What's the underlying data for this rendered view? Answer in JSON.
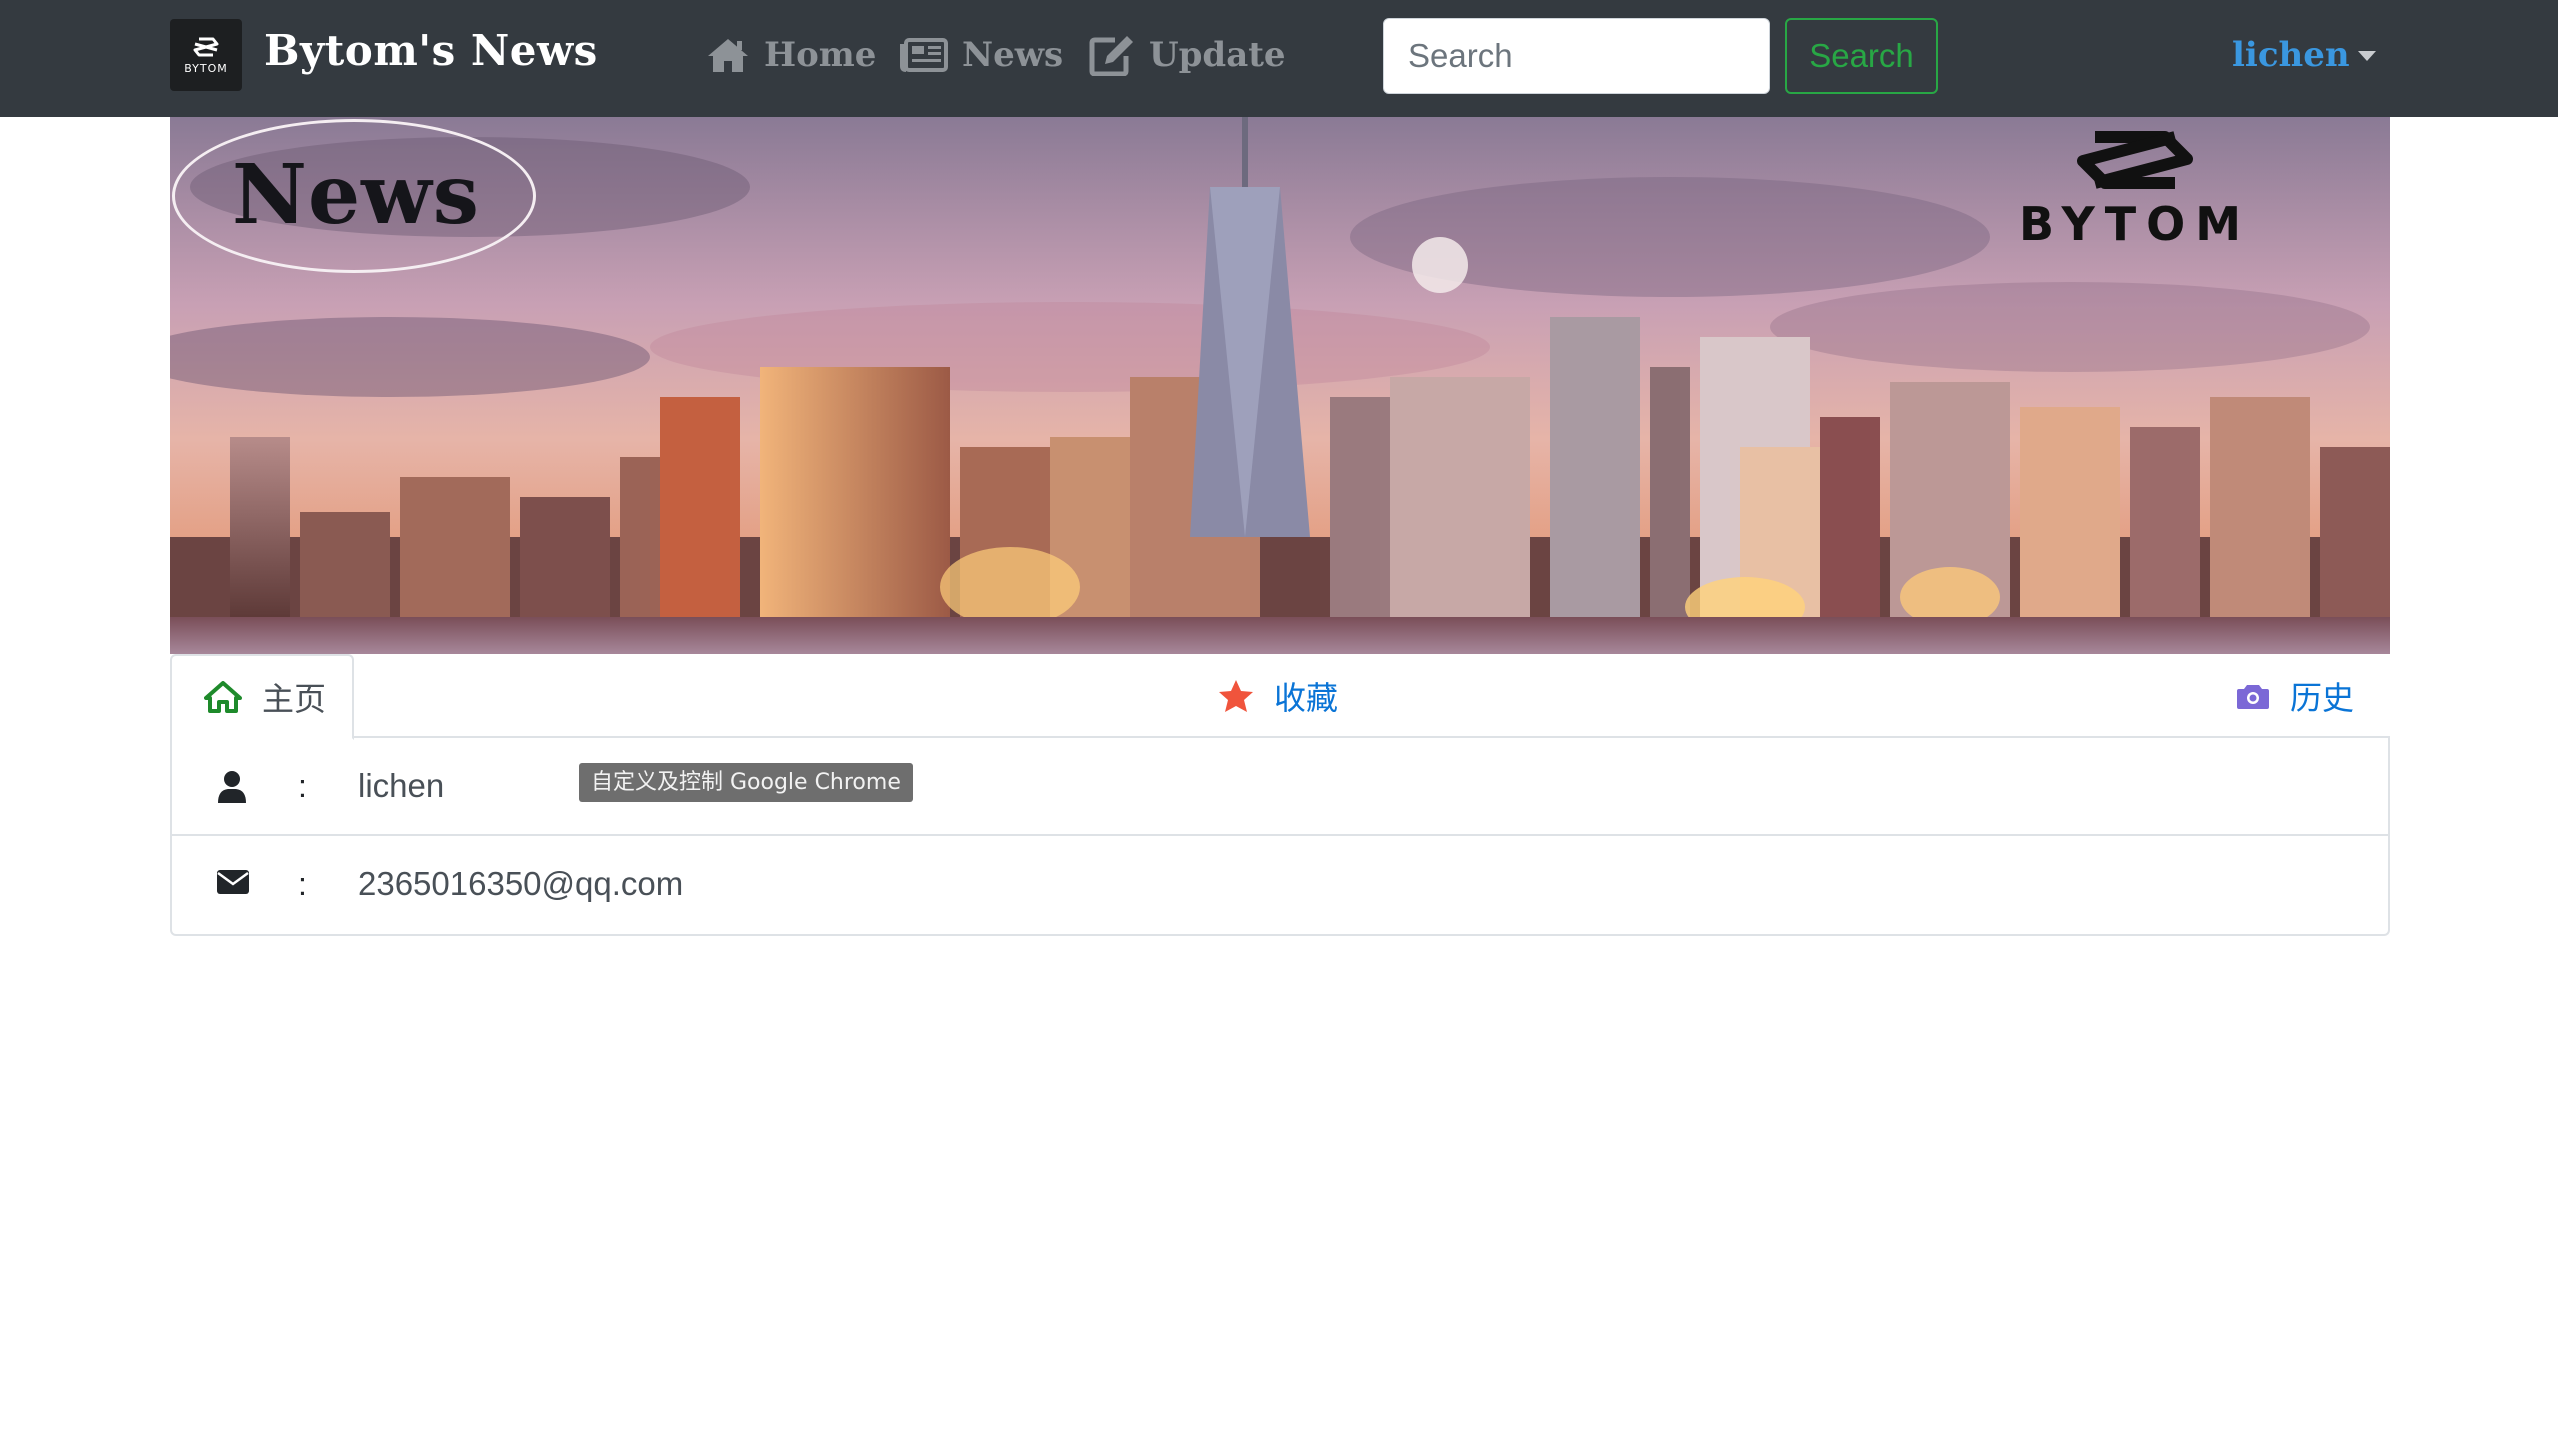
{
  "navbar": {
    "brand_logo_text": "BYTOM",
    "brand_title": "Bytom's News",
    "links": [
      {
        "label": "Home",
        "icon": "home-icon"
      },
      {
        "label": "News",
        "icon": "newspaper-icon"
      },
      {
        "label": "Update",
        "icon": "edit-icon"
      }
    ],
    "search": {
      "placeholder": "Search",
      "value": "",
      "button_label": "Search"
    },
    "user": {
      "name": "lichen",
      "icon": "chevron-down-icon"
    }
  },
  "banner": {
    "title": "News",
    "logo_text": "BYTOM"
  },
  "tabs": [
    {
      "label": "主页",
      "icon": "home-icon",
      "active": true
    },
    {
      "label": "收藏",
      "icon": "star-icon",
      "active": false
    },
    {
      "label": "历史",
      "icon": "camera-icon",
      "active": false
    }
  ],
  "profile": {
    "separator": ":",
    "username": "lichen",
    "email": "2365016350@qq.com"
  },
  "tooltip": {
    "text": "自定义及控制 Google Chrome"
  },
  "colors": {
    "navbar_bg": "#343a40",
    "nav_link": "#8d9297",
    "search_button": "#28a745",
    "user_link": "#3a97e0",
    "tab_link": "#0a74d6",
    "home_tab_icon": "#1e8a2b",
    "star_icon": "#f0543c",
    "camera_icon": "#7b68d6"
  }
}
